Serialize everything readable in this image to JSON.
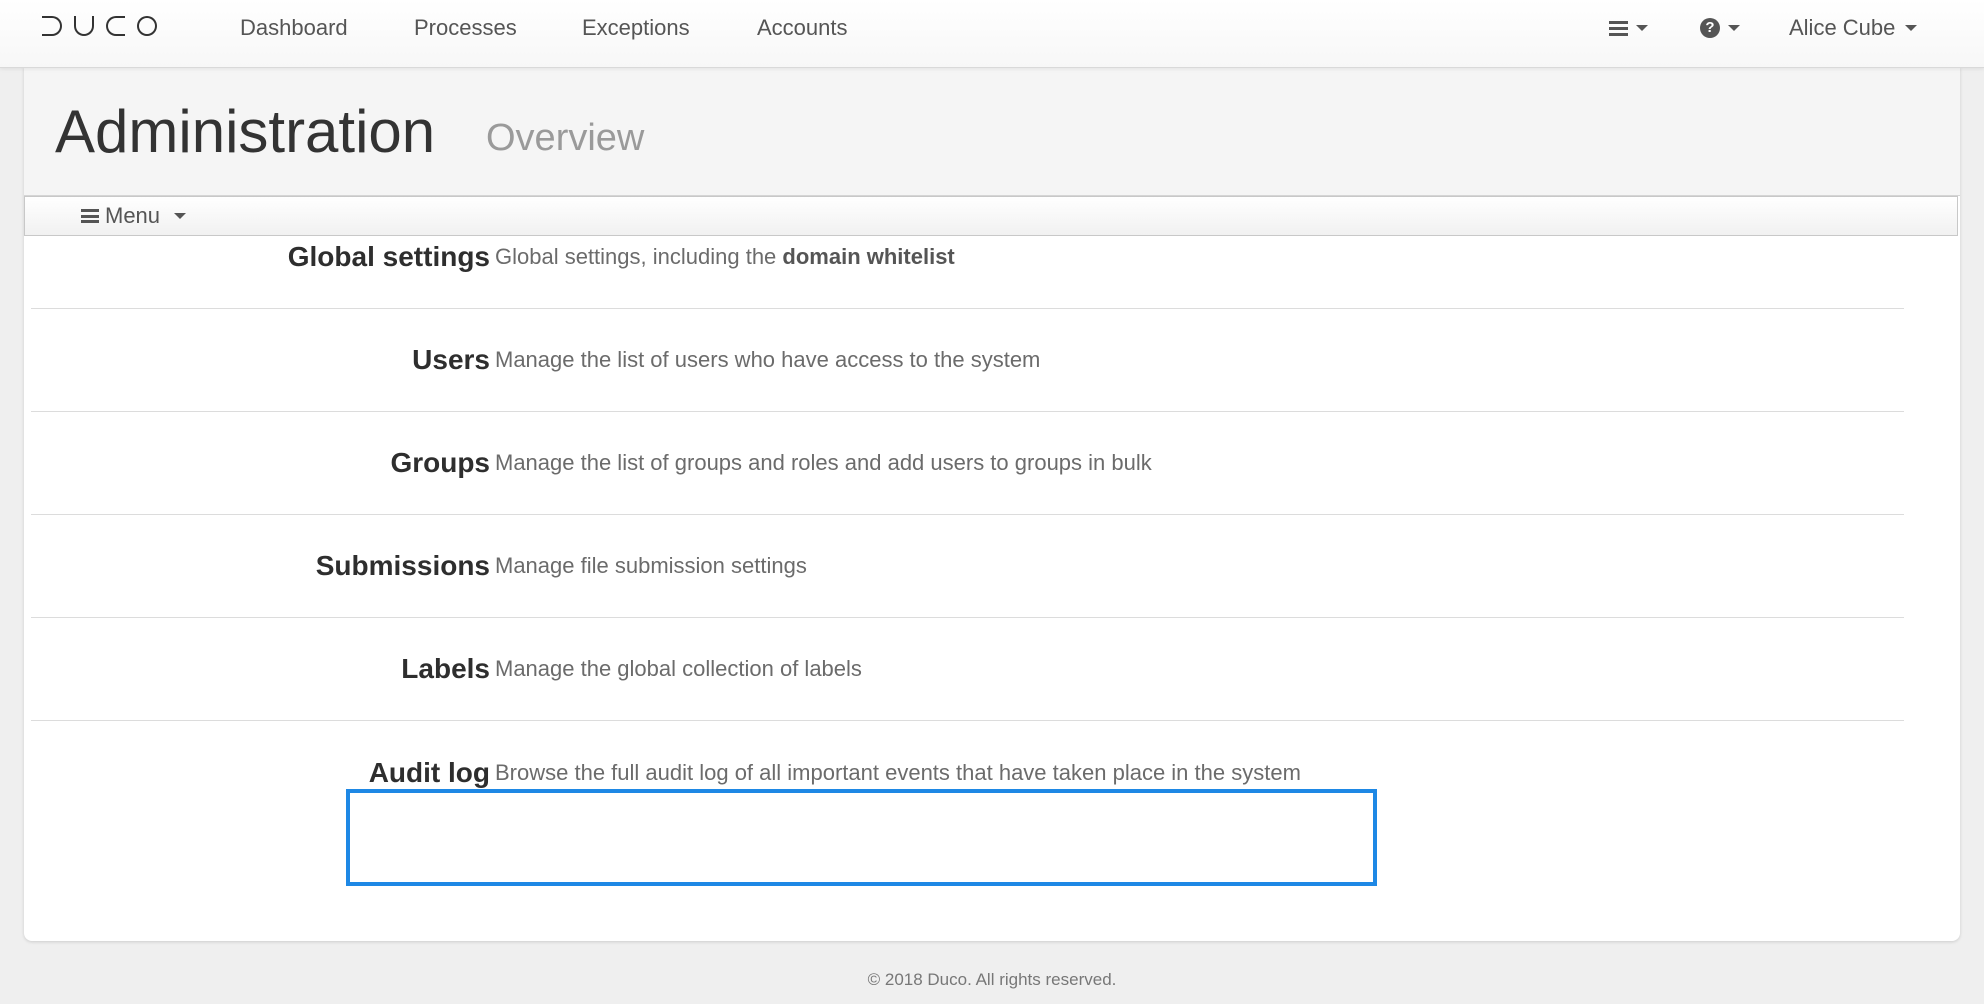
{
  "app": {
    "brand": "DUCO",
    "nav": [
      {
        "label": "Dashboard"
      },
      {
        "label": "Processes"
      },
      {
        "label": "Exceptions"
      },
      {
        "label": "Accounts"
      }
    ],
    "user": {
      "name": "Alice Cube"
    }
  },
  "page": {
    "title": "Administration",
    "subtitle": "Overview"
  },
  "menu": {
    "label": "Menu"
  },
  "items": [
    {
      "title": "Global settings",
      "desc_prefix": "Global settings, including the ",
      "desc_bold": "domain whitelist"
    },
    {
      "title": "Users",
      "desc": "Manage the list of users who have access to the system"
    },
    {
      "title": "Groups",
      "desc": "Manage the list of groups and roles and add users to groups in bulk"
    },
    {
      "title": "Submissions",
      "desc": "Manage file submission settings"
    },
    {
      "title": "Labels",
      "desc": "Manage the global collection of labels"
    },
    {
      "title": "Audit log",
      "desc": "Browse the full audit log of all important events that have taken place in the system"
    }
  ],
  "footer": {
    "text": "© 2018 Duco. All rights reserved."
  },
  "colors": {
    "highlight": "#1e88e5"
  },
  "icons": {
    "menu": "hamburger-icon",
    "help": "help-circle-icon",
    "dropdown": "caret-down-icon"
  }
}
